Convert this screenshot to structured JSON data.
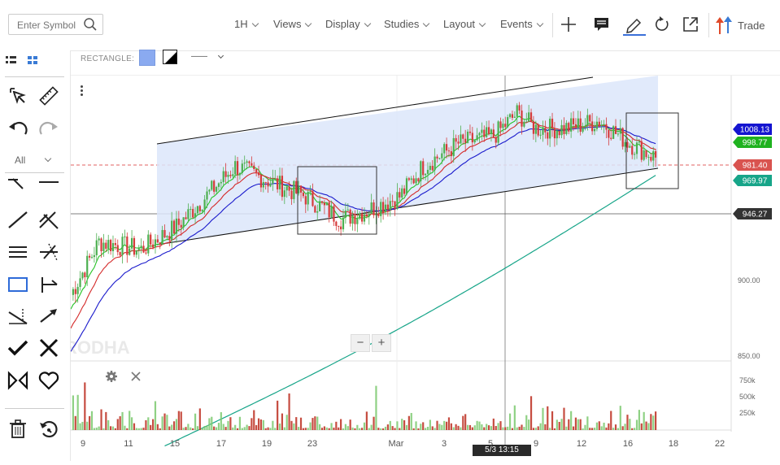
{
  "toolbar": {
    "search_placeholder": "Enter Symbol",
    "menus": [
      {
        "label": "1H"
      },
      {
        "label": "Views"
      },
      {
        "label": "Display"
      },
      {
        "label": "Studies"
      },
      {
        "label": "Layout"
      },
      {
        "label": "Events"
      }
    ],
    "trade_label": "Trade",
    "icons": [
      "plus-icon",
      "comment-icon",
      "pencil-icon",
      "reset-icon",
      "popout-icon",
      "trade-arrows-icon"
    ]
  },
  "drawing_bar": {
    "tool_label": "RECTANGLE:",
    "fill_color": "#8aaaf0",
    "line_style": "——"
  },
  "left_tools": {
    "filter_label": "All"
  },
  "chart": {
    "watermark": "RODHA",
    "zoom_minus": "−",
    "zoom_plus": "+",
    "price_labels": [
      {
        "text": "1008.13",
        "bg": "#1414d0"
      },
      {
        "text": "998.77",
        "bg": "#1fb21f"
      },
      {
        "text": "981.40",
        "bg": "#d9534f"
      },
      {
        "text": "969.97",
        "bg": "#17a589"
      },
      {
        "text": "946.27",
        "bg": "#333333"
      }
    ],
    "y_ticks": [
      "900.00",
      "850.00"
    ],
    "volume_ticks": [
      "750k",
      "500k",
      "250k"
    ],
    "x_ticks": [
      "9",
      "11",
      "15",
      "17",
      "19",
      "23",
      "Mar",
      "3",
      "5",
      "9",
      "12",
      "16",
      "18",
      "22"
    ],
    "crosshair_label": "5/3 13:15",
    "colors": {
      "ema_blue": "#1a1acc",
      "ema_red": "#d42a2a",
      "ema_green": "#26c426",
      "ema_teal": "#17a589",
      "candle_up": "#4caf50",
      "candle_down": "#d63b3b",
      "channel_fill": "#dce6fa"
    }
  }
}
